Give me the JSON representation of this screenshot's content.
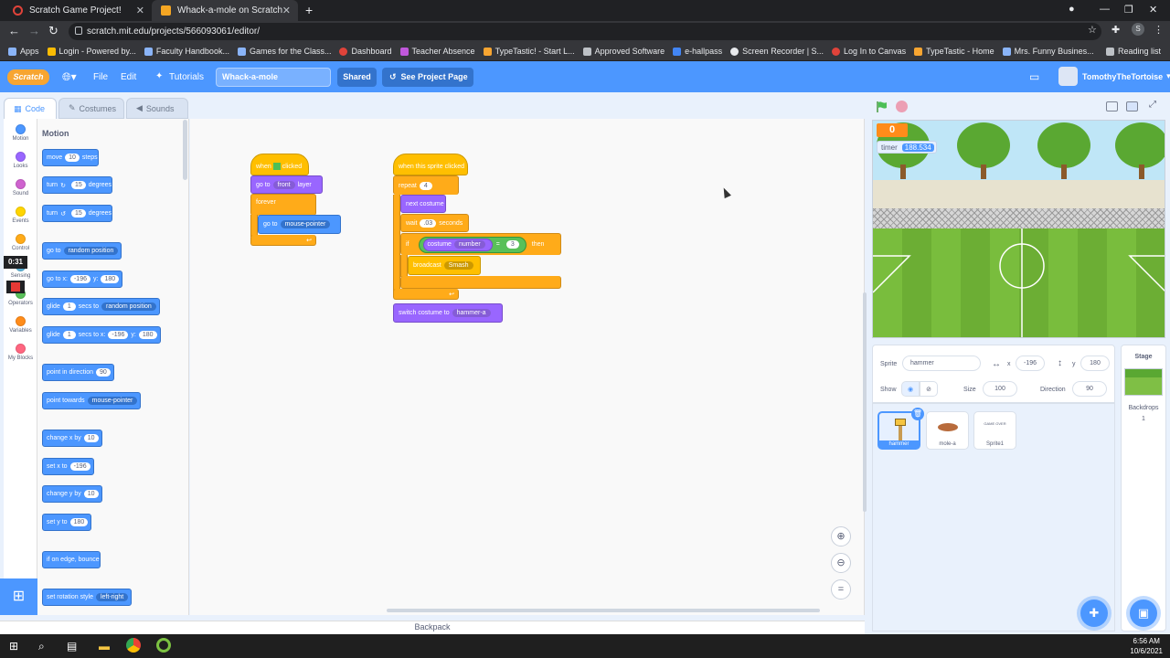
{
  "browser": {
    "tabs": [
      {
        "title": "Scratch Game Project!"
      },
      {
        "title": "Whack-a-mole on Scratch"
      }
    ],
    "url": "scratch.mit.edu/projects/566093061/editor/",
    "bookmarks": [
      "Apps",
      "Login - Powered by...",
      "Faculty Handbook...",
      "Games for the Class...",
      "Dashboard",
      "Teacher Absence",
      "TypeTastic! - Start L...",
      "Approved Software",
      "e-hallpass",
      "Screen Recorder | S...",
      "Log In to Canvas",
      "TypeTastic - Home",
      "Mrs. Funny Busines..."
    ],
    "reading_list": "Reading list",
    "profile_initial": "S"
  },
  "menu": {
    "logo": "Scratch",
    "file": "File",
    "edit": "Edit",
    "tutorials": "Tutorials",
    "project_title": "Whack-a-mole",
    "shared": "Shared",
    "see_project": "See Project Page",
    "username": "TomothyTheTortoise"
  },
  "editor_tabs": {
    "code": "Code",
    "costumes": "Costumes",
    "sounds": "Sounds"
  },
  "categories": [
    {
      "label": "Motion",
      "color": "#4c97ff"
    },
    {
      "label": "Looks",
      "color": "#9966ff"
    },
    {
      "label": "Sound",
      "color": "#cf63cf"
    },
    {
      "label": "Events",
      "color": "#ffd500"
    },
    {
      "label": "Control",
      "color": "#ffab19"
    },
    {
      "label": "Sensing",
      "color": "#5cb1d6"
    },
    {
      "label": "Operators",
      "color": "#59c059"
    },
    {
      "label": "Variables",
      "color": "#ff8c1a"
    },
    {
      "label": "My Blocks",
      "color": "#ff6680"
    }
  ],
  "recorder_time": "0:31",
  "palette": {
    "heading": "Motion",
    "move": {
      "a": "move",
      "v": "10",
      "b": "steps"
    },
    "turn_right": {
      "a": "turn",
      "v": "15",
      "b": "degrees"
    },
    "turn_left": {
      "a": "turn",
      "v": "15",
      "b": "degrees"
    },
    "goto": {
      "a": "go to",
      "d": "random position"
    },
    "goto_xy": {
      "a": "go to x:",
      "x": "-196",
      "y_label": "y:",
      "y": "180"
    },
    "glide_to": {
      "a": "glide",
      "v": "1",
      "b": "secs to",
      "d": "random position"
    },
    "glide_xy": {
      "a": "glide",
      "v": "1",
      "b": "secs to x:",
      "x": "-196",
      "y_label": "y:",
      "y": "180"
    },
    "point_dir": {
      "a": "point in direction",
      "v": "90"
    },
    "point_towards": {
      "a": "point towards",
      "d": "mouse-pointer"
    },
    "change_x": {
      "a": "change x by",
      "v": "10"
    },
    "set_x": {
      "a": "set x to",
      "v": "-196"
    },
    "change_y": {
      "a": "change y by",
      "v": "10"
    },
    "set_y": {
      "a": "set y to",
      "v": "180"
    },
    "bounce": {
      "a": "if on edge, bounce"
    },
    "rotation": {
      "a": "set rotation style",
      "d": "left-right"
    }
  },
  "script1": {
    "when": "when",
    "clicked": "clicked",
    "goto": "go to",
    "front": "front",
    "layer": "layer",
    "forever": "forever",
    "goto2": "go to",
    "mouse": "mouse-pointer"
  },
  "script2": {
    "hat": "when this sprite clicked",
    "repeat": "repeat",
    "repeat_n": "4",
    "next_costume": "next costume",
    "wait": "wait",
    "wait_v": ".03",
    "seconds": "seconds",
    "if": "if",
    "costume": "costume",
    "number": "number",
    "eq": "=",
    "eq_v": "3",
    "then": "then",
    "broadcast": "broadcast",
    "msg": "Smash",
    "switch": "switch costume to",
    "switch_d": "hammer-a"
  },
  "backpack": "Backpack",
  "stage": {
    "score": "0",
    "timer_label": "timer",
    "timer_value": "188.534"
  },
  "sprite_info": {
    "sprite_label": "Sprite",
    "sprite_name": "hammer",
    "x_label": "x",
    "x": "-196",
    "y_label": "y",
    "y": "180",
    "show_label": "Show",
    "size_label": "Size",
    "size": "100",
    "direction_label": "Direction",
    "direction": "90"
  },
  "sprites": [
    {
      "name": "hammer"
    },
    {
      "name": "mole-a"
    },
    {
      "name": "Sprite1",
      "preview": "GAME OVER"
    }
  ],
  "stage_panel": {
    "title": "Stage",
    "backdrops_label": "Backdrops",
    "backdrops": "1"
  },
  "clock": {
    "time": "6:56 AM",
    "date": "10/6/2021"
  }
}
